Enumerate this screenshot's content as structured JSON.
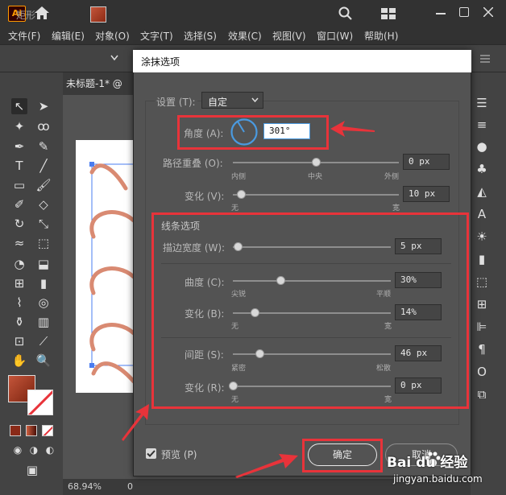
{
  "app": {
    "logo": "Ai",
    "menu": [
      "文件(F)",
      "编辑(E)",
      "对象(O)",
      "文字(T)",
      "选择(S)",
      "效果(C)",
      "视图(V)",
      "窗口(W)",
      "帮助(H)"
    ],
    "tool_label": "矩形",
    "doc_tab": "未标题-1* @",
    "zoom": "68.94%",
    "status_num": "0"
  },
  "dialog": {
    "title": "涂抹选项",
    "settings_label": "设置 (T):",
    "settings_value": "自定",
    "angle_label": "角度 (A):",
    "angle_value": "301°",
    "path_overlap_label": "路径重叠 (O):",
    "path_overlap_value": "0 px",
    "path_overlap_min": "内侧",
    "path_overlap_mid": "中央",
    "path_overlap_max": "外侧",
    "variation1_label": "变化 (V):",
    "variation1_value": "10 px",
    "variation1_min": "无",
    "variation1_max": "宽",
    "line_options_label": "线条选项",
    "stroke_width_label": "描边宽度 (W):",
    "stroke_width_value": "5 px",
    "curviness_label": "曲度 (C):",
    "curviness_value": "30%",
    "curviness_min": "尖锐",
    "curviness_max": "平顺",
    "variation2_label": "变化 (B):",
    "variation2_value": "14%",
    "variation2_min": "无",
    "variation2_max": "宽",
    "spacing_label": "间距 (S):",
    "spacing_value": "46 px",
    "spacing_min": "紧密",
    "spacing_max": "松散",
    "variation3_label": "变化 (R):",
    "variation3_value": "0 px",
    "variation3_min": "无",
    "variation3_max": "宽",
    "preview_label": "预览 (P)",
    "ok_label": "确定",
    "cancel_label": "取消"
  },
  "slider_levels": {
    "path_overlap": 0.5,
    "variation1": 0.05,
    "stroke_width": 0.03,
    "curviness": 0.3,
    "variation2": 0.14,
    "spacing": 0.17,
    "variation3": 0.0
  },
  "watermark": {
    "brand": "Bai du 经验",
    "url": "jingyan.baidu.com"
  },
  "colors": {
    "highlight_red": "#e8333a",
    "scribble": "#d98a72",
    "ai_orange": "#ff9a00"
  }
}
